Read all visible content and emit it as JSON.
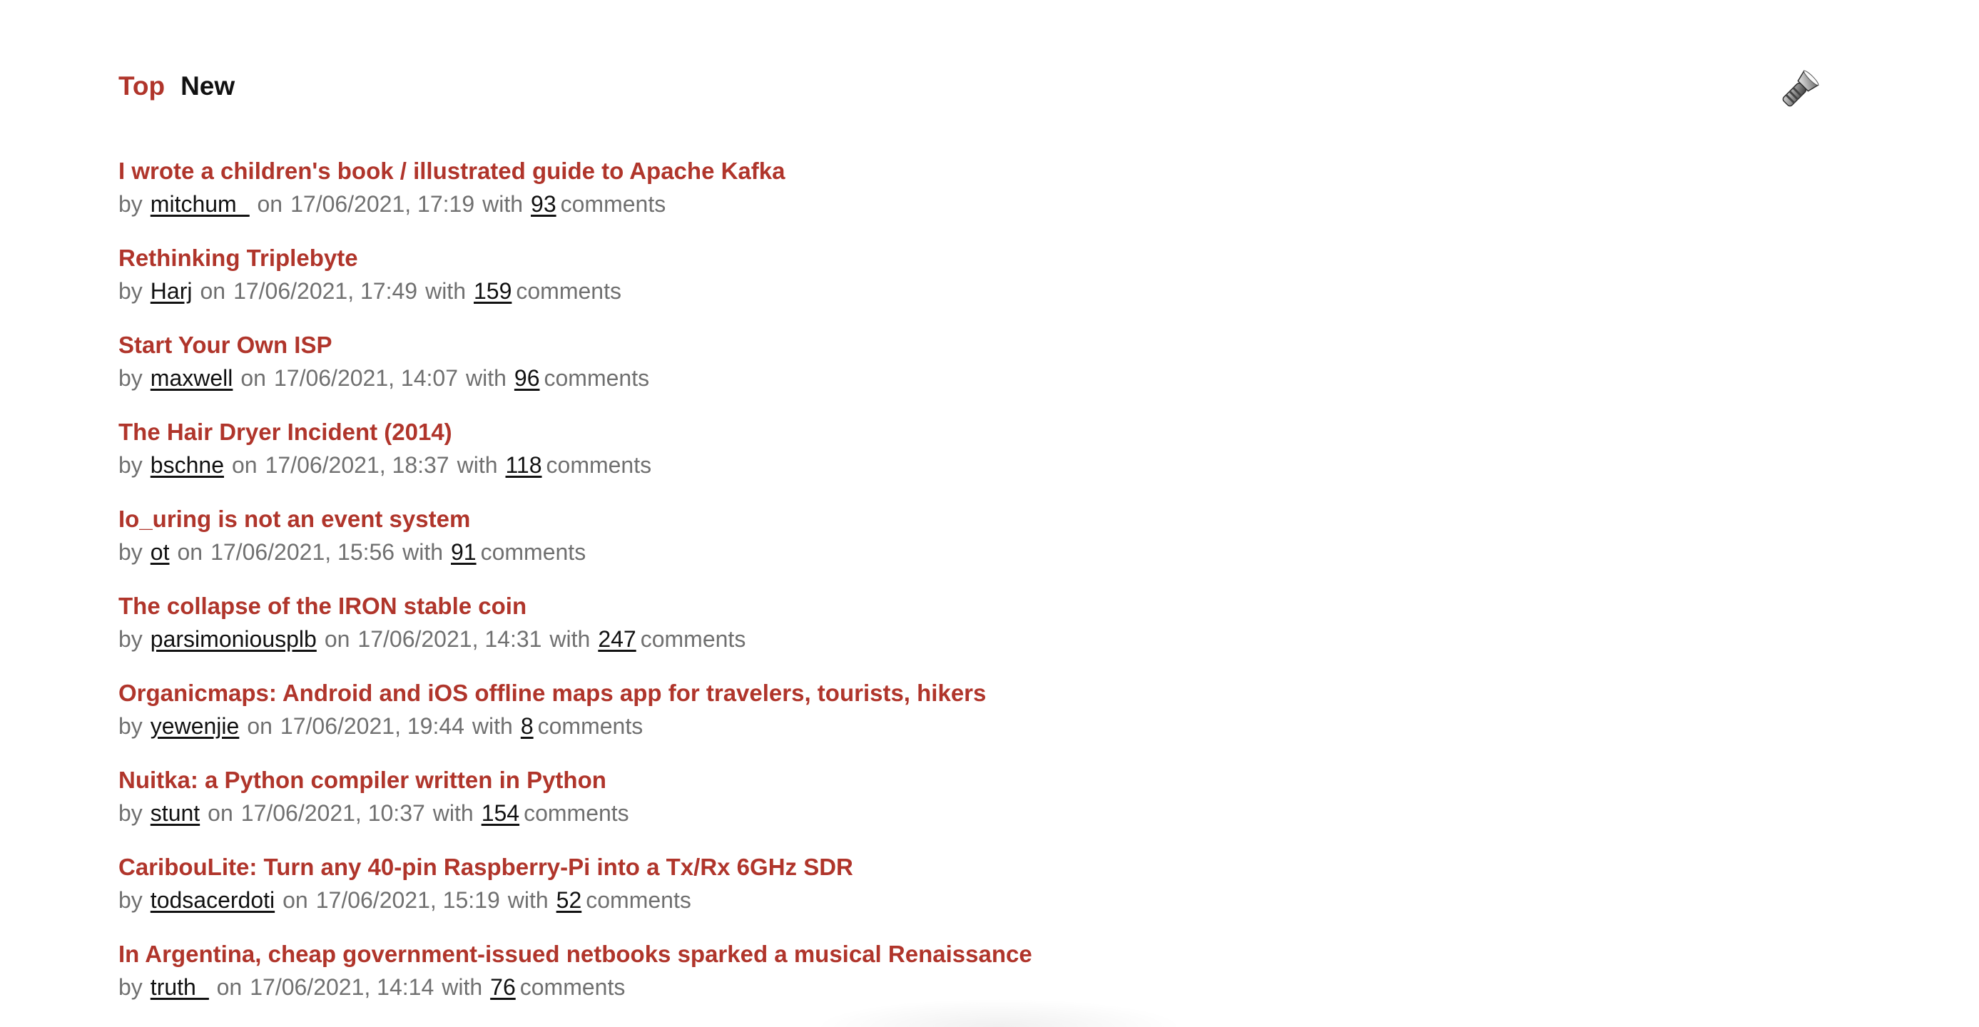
{
  "nav": {
    "tabs": [
      {
        "label": "Top",
        "active": true
      },
      {
        "label": "New",
        "active": false
      }
    ]
  },
  "theme_toggle": {
    "icon": "flashlight-icon"
  },
  "meta_words": {
    "by": "by",
    "on": "on",
    "with": "with",
    "comments": "comments"
  },
  "colors": {
    "accent": "#b0352b",
    "meta_text": "#707070",
    "link": "#111111"
  },
  "stories": [
    {
      "title": "I wrote a children's book / illustrated guide to Apache Kafka",
      "author": "mitchum_",
      "date": "17/06/2021, 17:19",
      "comments": "93"
    },
    {
      "title": "Rethinking Triplebyte",
      "author": "Harj",
      "date": "17/06/2021, 17:49",
      "comments": "159"
    },
    {
      "title": "Start Your Own ISP",
      "author": "maxwell",
      "date": "17/06/2021, 14:07",
      "comments": "96"
    },
    {
      "title": "The Hair Dryer Incident (2014)",
      "author": "bschne",
      "date": "17/06/2021, 18:37",
      "comments": "118"
    },
    {
      "title": "Io_uring is not an event system",
      "author": "ot",
      "date": "17/06/2021, 15:56",
      "comments": "91"
    },
    {
      "title": "The collapse of the IRON stable coin",
      "author": "parsimoniousplb",
      "date": "17/06/2021, 14:31",
      "comments": "247"
    },
    {
      "title": "Organicmaps: Android and iOS offline maps app for travelers, tourists, hikers",
      "author": "yewenjie",
      "date": "17/06/2021, 19:44",
      "comments": "8"
    },
    {
      "title": "Nuitka: a Python compiler written in Python",
      "author": "stunt",
      "date": "17/06/2021, 10:37",
      "comments": "154"
    },
    {
      "title": "CaribouLite: Turn any 40-pin Raspberry-Pi into a Tx/Rx 6GHz SDR",
      "author": "todsacerdoti",
      "date": "17/06/2021, 15:19",
      "comments": "52"
    },
    {
      "title": "In Argentina, cheap government-issued netbooks sparked a musical Renaissance",
      "author": "truth_",
      "date": "17/06/2021, 14:14",
      "comments": "76"
    }
  ]
}
